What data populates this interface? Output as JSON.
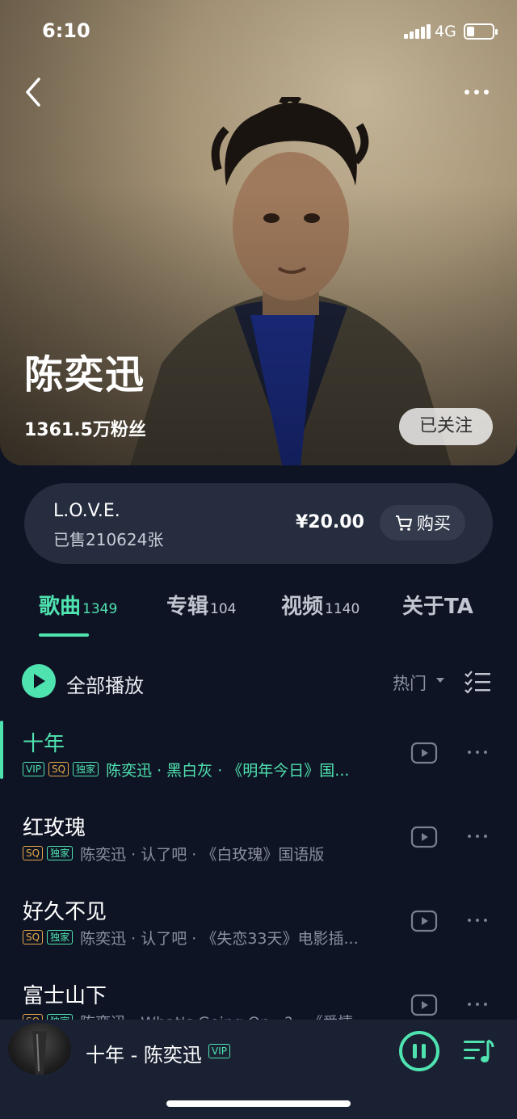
{
  "status_bar": {
    "time": "6:10",
    "network": "4G"
  },
  "artist": {
    "name": "陈奕迅",
    "fans": "1361.5万粉丝",
    "follow_label": "已关注"
  },
  "album": {
    "title": "L.O.V.E.",
    "sold": "已售210624张",
    "price": "¥20.00",
    "buy_label": "购买"
  },
  "tabs": [
    {
      "label": "歌曲",
      "count": "1349",
      "active": true
    },
    {
      "label": "专辑",
      "count": "104",
      "active": false
    },
    {
      "label": "视频",
      "count": "1140",
      "active": false
    },
    {
      "label": "关于TA",
      "count": "",
      "active": false
    }
  ],
  "controls": {
    "play_all_label": "全部播放",
    "sort_label": "热门"
  },
  "songs": [
    {
      "title": "十年",
      "badges": [
        "VIP",
        "SQ",
        "独家"
      ],
      "meta": "陈奕迅 · 黑白灰 · 《明年今日》国...",
      "active": true
    },
    {
      "title": "红玫瑰",
      "badges": [
        "SQ",
        "独家"
      ],
      "meta": "陈奕迅 · 认了吧 · 《白玫瑰》国语版",
      "active": false
    },
    {
      "title": "好久不见",
      "badges": [
        "SQ",
        "独家"
      ],
      "meta": "陈奕迅 · 认了吧 · 《失恋33天》电影插...",
      "active": false
    },
    {
      "title": "富士山下",
      "badges": [
        "SQ",
        "独家"
      ],
      "meta": "陈奕迅 · What's Going On...? · 《爱情...",
      "active": false
    }
  ],
  "now_playing": {
    "title": "十年 - 陈奕迅",
    "badge": "VIP"
  },
  "colors": {
    "accent": "#4fe3b0",
    "background": "#0f1424",
    "card": "#252d3f",
    "sq": "#e6a94a"
  }
}
